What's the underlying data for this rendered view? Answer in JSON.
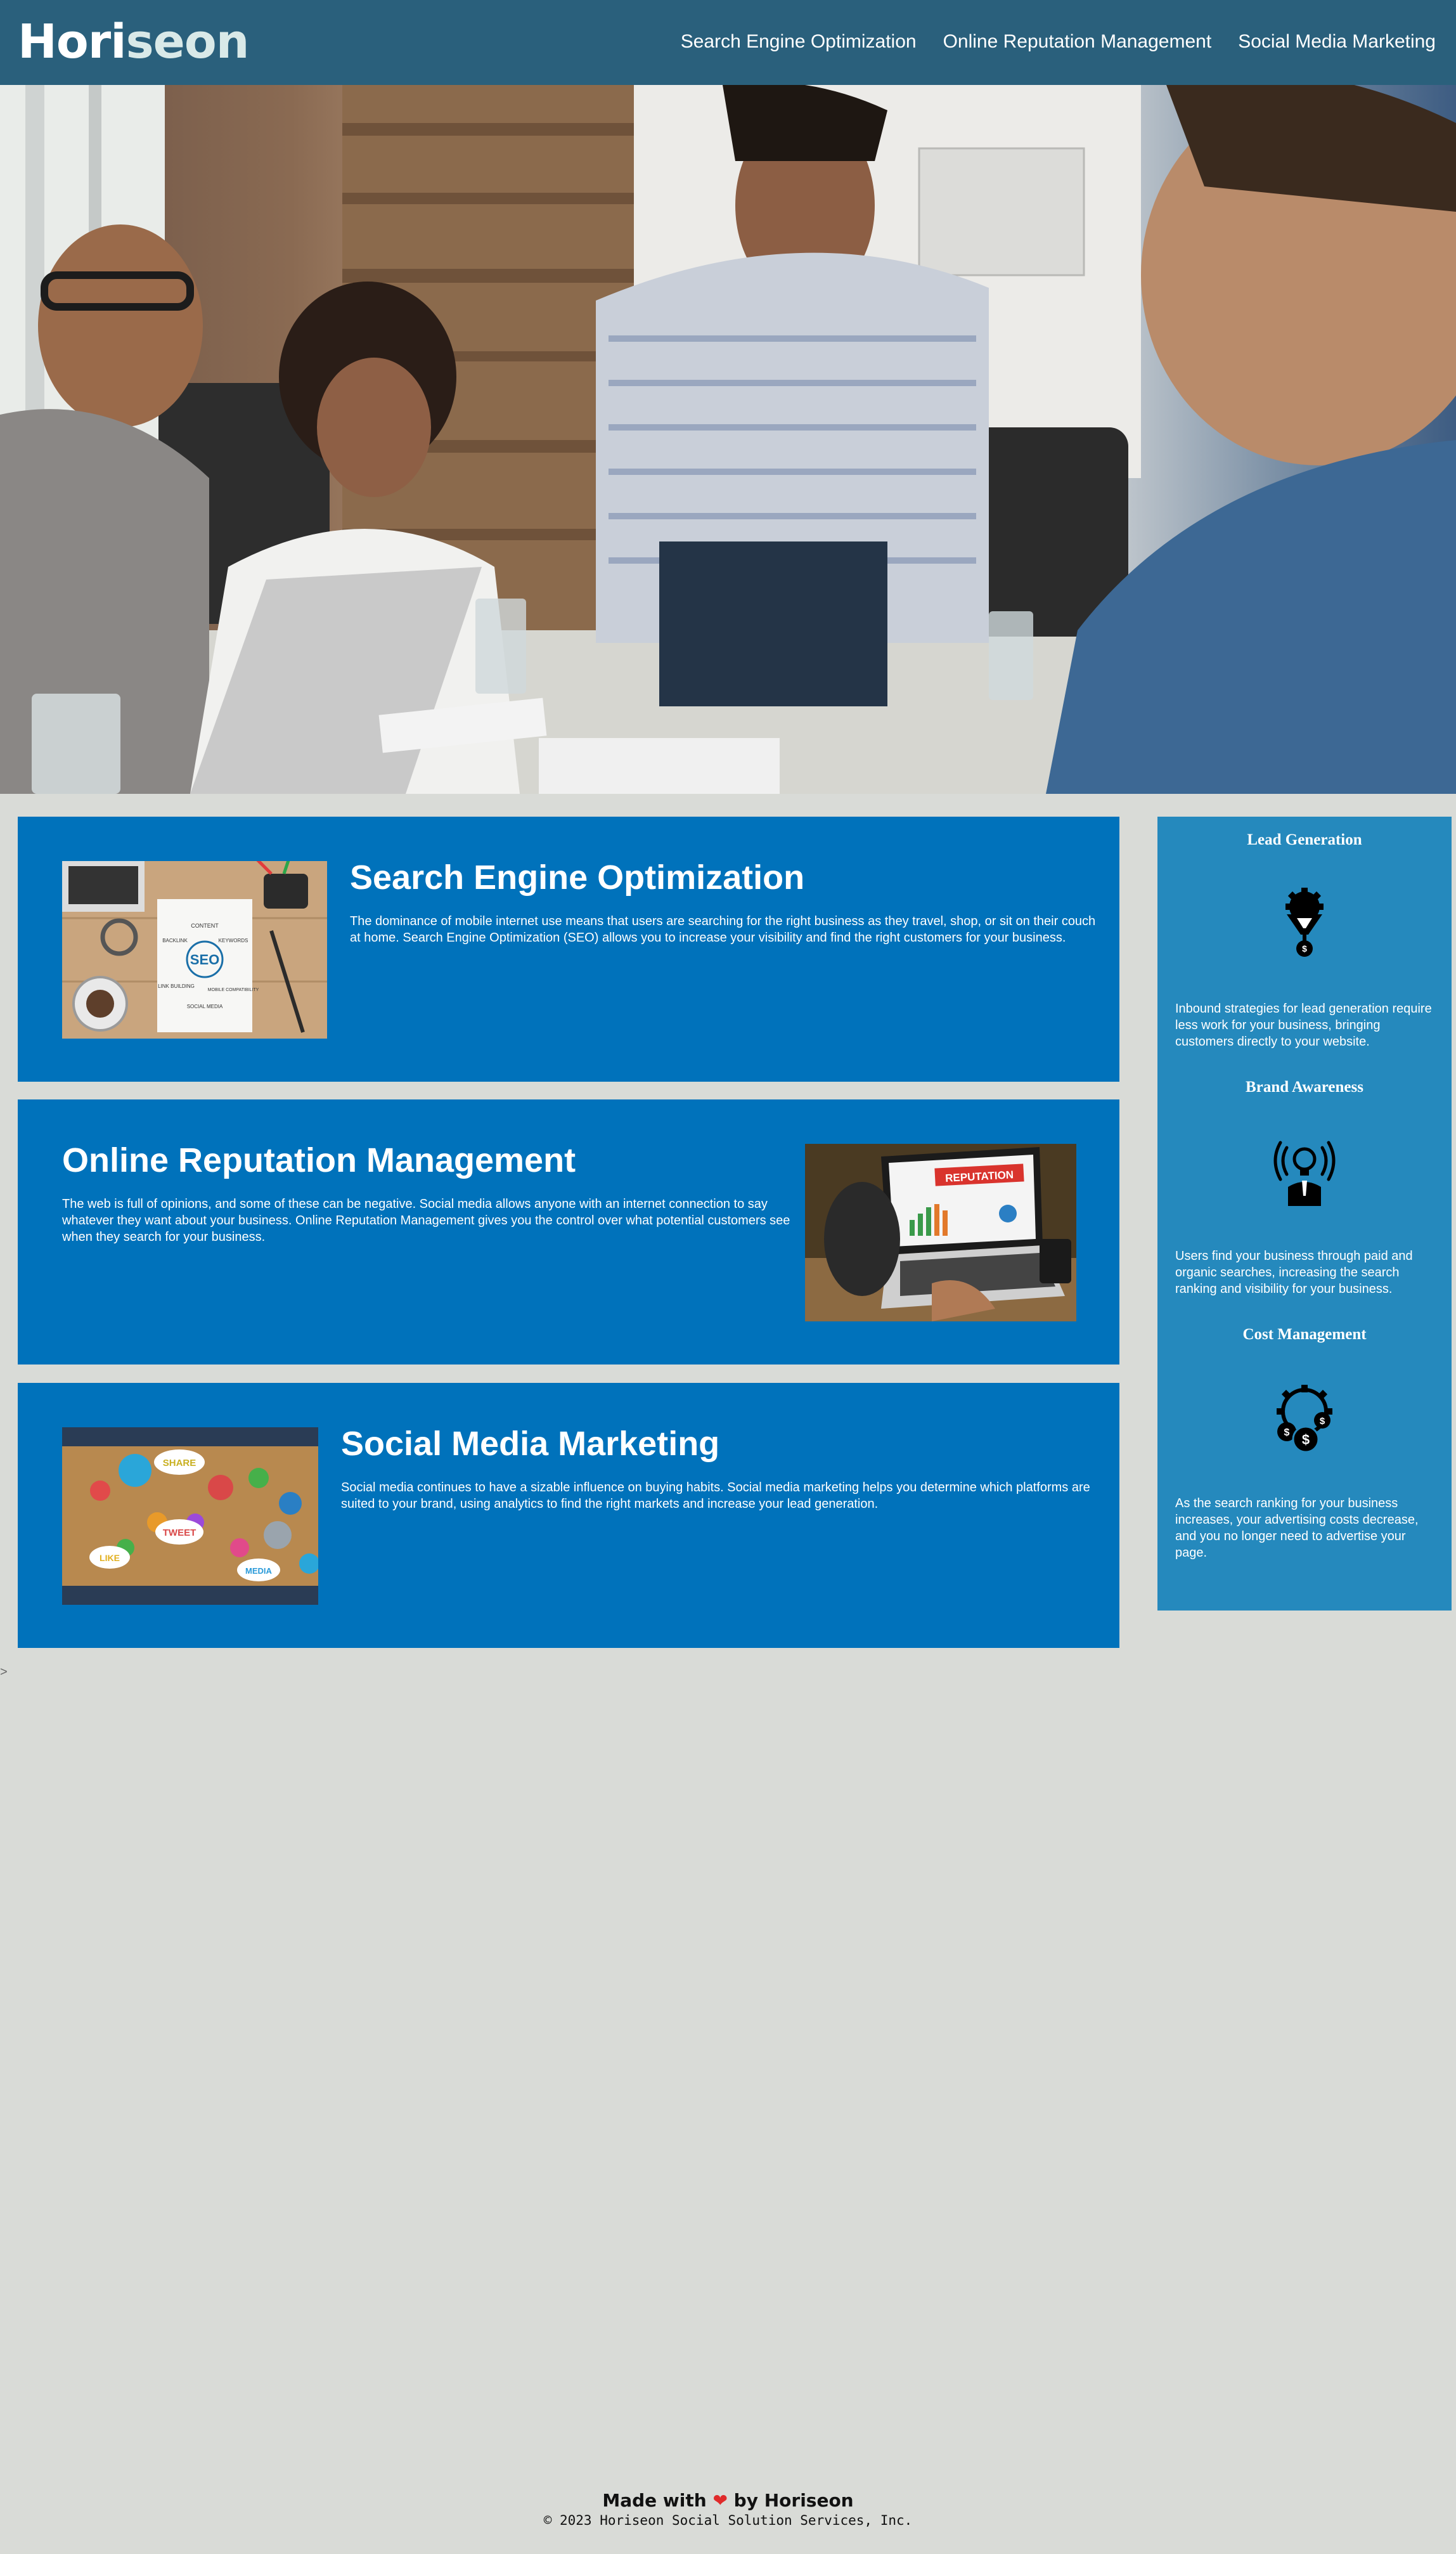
{
  "header": {
    "logo_part1": "Hori",
    "logo_part2": "seon",
    "nav": [
      {
        "label": "Search Engine Optimization"
      },
      {
        "label": "Online Reputation Management"
      },
      {
        "label": "Social Media Marketing"
      }
    ]
  },
  "hero": {
    "icon": "team-meeting-photo"
  },
  "content": [
    {
      "title": "Search Engine Optimization",
      "text": "The dominance of mobile internet use means that users are searching for the right business as they travel, shop, or sit on their couch at home. Search Engine Optimization (SEO) allows you to increase your visibility and find the right customers for your business.",
      "image_words": [
        "CONTENT",
        "BACKLINK",
        "KEYWORDS",
        "SEO",
        "LINK BUILDING",
        "MOBILE COMPATIBILITY",
        "SOCIAL MEDIA"
      ]
    },
    {
      "title": "Online Reputation Management",
      "text": "The web is full of opinions, and some of these can be negative. Social media allows anyone with an internet connection to say whatever they want about your business. Online Reputation Management gives you the control over what potential customers see when they search for your business.",
      "image_words": [
        "REPUTATION"
      ]
    },
    {
      "title": "Social Media Marketing",
      "text": "Social media continues to have a sizable influence on buying habits. Social media marketing helps you determine which platforms are suited to your brand, using analytics to find the right markets and increase your lead generation.",
      "image_words": [
        "LIKE",
        "TWEET",
        "MEDIA",
        "SHARE"
      ]
    }
  ],
  "benefits": [
    {
      "title": "Lead Generation",
      "icon": "lead-funnel-gear-icon",
      "text": "Inbound strategies for lead generation require less work for your business, bringing customers directly to your website."
    },
    {
      "title": "Brand Awareness",
      "icon": "broadcast-lightbulb-icon",
      "text": "Users find your business through paid and organic searches, increasing the search ranking and visibility for your business."
    },
    {
      "title": "Cost Management",
      "icon": "gear-coins-icon",
      "text": "As the search ranking for your business increases, your advertising costs decrease, and you no longer need to advertise your page."
    }
  ],
  "stray_char": ">",
  "footer": {
    "made_prefix": "Made with",
    "heart": "❤",
    "made_suffix": "by Horiseon",
    "copyright": "© 2023 Horiseon Social Solution Services, Inc."
  },
  "colors": {
    "header_bg": "#2a607c",
    "card_bg": "#0072bb",
    "sidebar_bg": "#2589bd",
    "page_bg": "#d9dbd7",
    "heart": "#e02a2a"
  }
}
